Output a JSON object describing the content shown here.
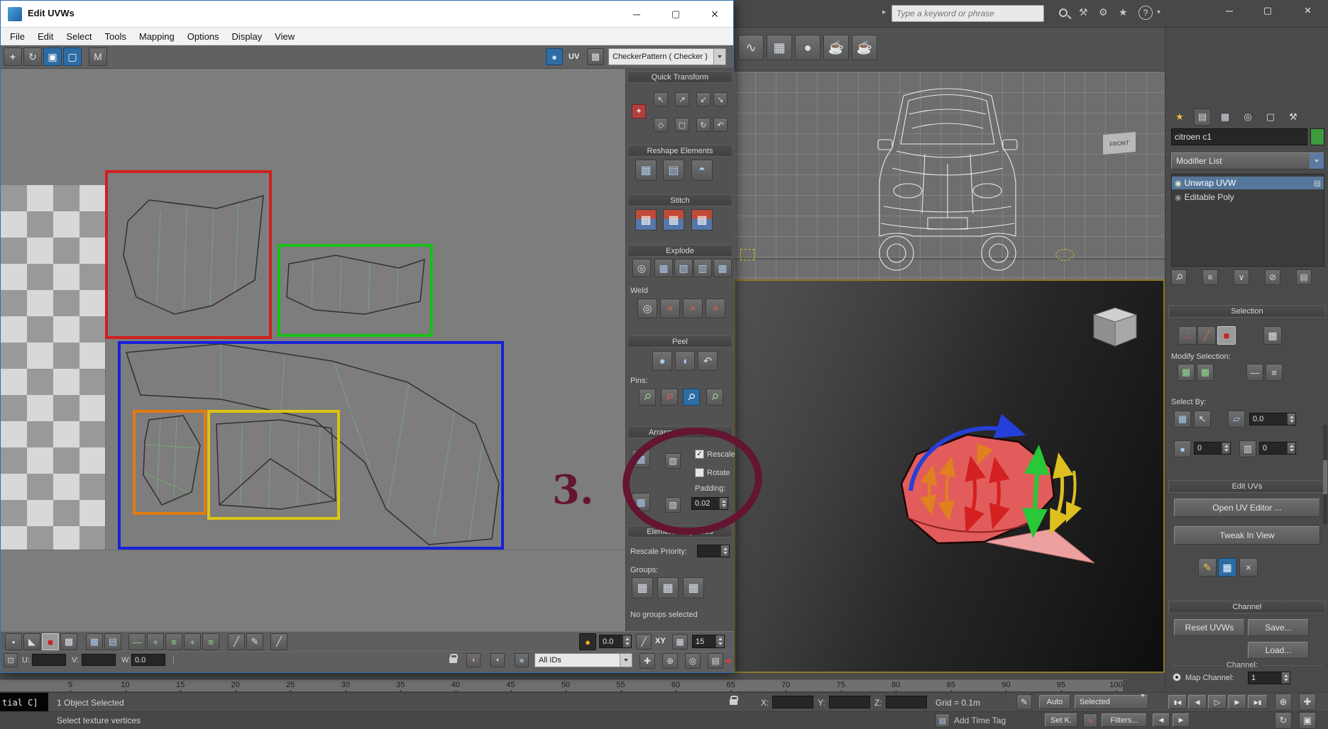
{
  "dialog": {
    "title": "Edit UVWs",
    "menus": [
      "File",
      "Edit",
      "Select",
      "Tools",
      "Mapping",
      "Options",
      "Display",
      "View"
    ],
    "toolbar": {
      "uv_label": "UV",
      "pattern_dropdown": "CheckerPattern ( Checker )"
    },
    "panel": {
      "quick_transform": "Quick Transform",
      "reshape_elements": "Reshape Elements",
      "stitch": "Stitch",
      "explode": "Explode",
      "weld": "Weld",
      "peel": "Peel",
      "pins_label": "Pins:",
      "arrange_elements": "Arrange Elements",
      "rescale_label": "Rescale",
      "rotate_label": "Rotate",
      "padding_label": "Padding:",
      "padding_value": "0.02",
      "element_properties": "Element Properties",
      "rescale_priority_label": "Rescale Priority:",
      "groups_label": "Groups:",
      "no_groups_text": "No groups selected"
    },
    "bottom": {
      "rotate_value": "0.0",
      "axis_label": "XY",
      "grid_value": "15",
      "u_label": "U:",
      "v_label": "V:",
      "w_label": "W:",
      "w_value": "0.0",
      "ids_dropdown": "All IDs"
    }
  },
  "annotation": {
    "number": "3."
  },
  "topbar": {
    "search_placeholder": "Type a keyword or phrase"
  },
  "viewports": {
    "front_gizmo": "FRONT"
  },
  "command_panel": {
    "object_name": "citroen c1",
    "modifier_list_label": "Modifier List",
    "stack": [
      {
        "label": "Unwrap UVW"
      },
      {
        "label": "Editable Poly"
      }
    ],
    "selection": {
      "header": "Selection",
      "modify_selection_label": "Modify Selection:",
      "select_by_label": "Select By:",
      "angle_value": "0.0",
      "spinner1": "0",
      "spinner2": "0"
    },
    "edit_uvs": {
      "header": "Edit UVs",
      "open_uv_editor": "Open UV Editor ...",
      "tweak_in_view": "Tweak In View"
    },
    "channel": {
      "header": "Channel",
      "reset_uvws": "Reset UVWs",
      "save": "Save...",
      "load": "Load...",
      "channel_label": "Channel:",
      "map_channel_label": "Map Channel:",
      "map_channel_value": "1"
    }
  },
  "timeline": {
    "ticks": [
      "5",
      "10",
      "15",
      "20",
      "25",
      "30",
      "35",
      "40",
      "45",
      "50",
      "55",
      "60",
      "65",
      "70",
      "75",
      "80",
      "85",
      "90",
      "95",
      "100"
    ]
  },
  "statusbar": {
    "listener_text": "tial C]",
    "selection_status": "1 Object Selected",
    "prompt": "Select texture vertices",
    "x_label": "X:",
    "y_label": "Y:",
    "z_label": "Z:",
    "grid_label": "Grid = 0.1m",
    "auto_label": "Auto",
    "selected_label": "Selected",
    "add_time_tag": "Add Time Tag",
    "set_key": "Set K.",
    "filters": "Filters..."
  },
  "colors": {
    "frame_red": "#d01f1f",
    "frame_green": "#17c017",
    "frame_blue": "#1722d8",
    "frame_orange": "#e27b12",
    "frame_yellow": "#ddc414",
    "annotation": "#641530",
    "selected_row": "#55779b",
    "shape_red": "#e25c5c",
    "accent_blue": "#2e6da4",
    "swatch_green": "#3e9b3e"
  },
  "icons": {
    "move": "+",
    "rotate": "↻",
    "scale": "▣",
    "freeform": "▢",
    "mirror": "M",
    "sphere": "●",
    "grid": "▦",
    "grid2": "▤",
    "grid3": "▥",
    "grid4": "▧",
    "dome": "◓",
    "circle": "◎",
    "dot": "•",
    "tri": "◣",
    "square": "■",
    "cube": "▩",
    "cross": "×",
    "pin": "⚲",
    "undo": "↶",
    "pencil": "✎",
    "plus": "+",
    "dash": "—",
    "lines": "≡",
    "slash": "╱",
    "check": "✓",
    "star": "★",
    "hammer": "⚒",
    "gear": "⚙",
    "teapot": "☕",
    "help": "?",
    "down": "▾",
    "caret": "▸",
    "bulb": "◉",
    "page": "▤",
    "snow": "∗",
    "globe": "⊕",
    "handpan": "✚",
    "arrow_nw": "↖",
    "arrow_ne": "↗",
    "arrow_sw": "↙",
    "arrow_se": "↘",
    "plane": "▱",
    "wave": "∿",
    "speaker": "◀",
    "minimize": "─",
    "maximize": "▢",
    "close": "×",
    "dots3": "∴",
    "diamond": "◇",
    "vee": "∨",
    "nul": "⊘",
    "boxdot": "⊡",
    "back": "◀",
    "fwd": "▶",
    "play": "▷",
    "rew": "◀◀",
    "ff": "▶▶",
    "firstf": "▮◀",
    "lastf": "▶▮",
    "halfdisc": "◖",
    "pipe": "|"
  }
}
